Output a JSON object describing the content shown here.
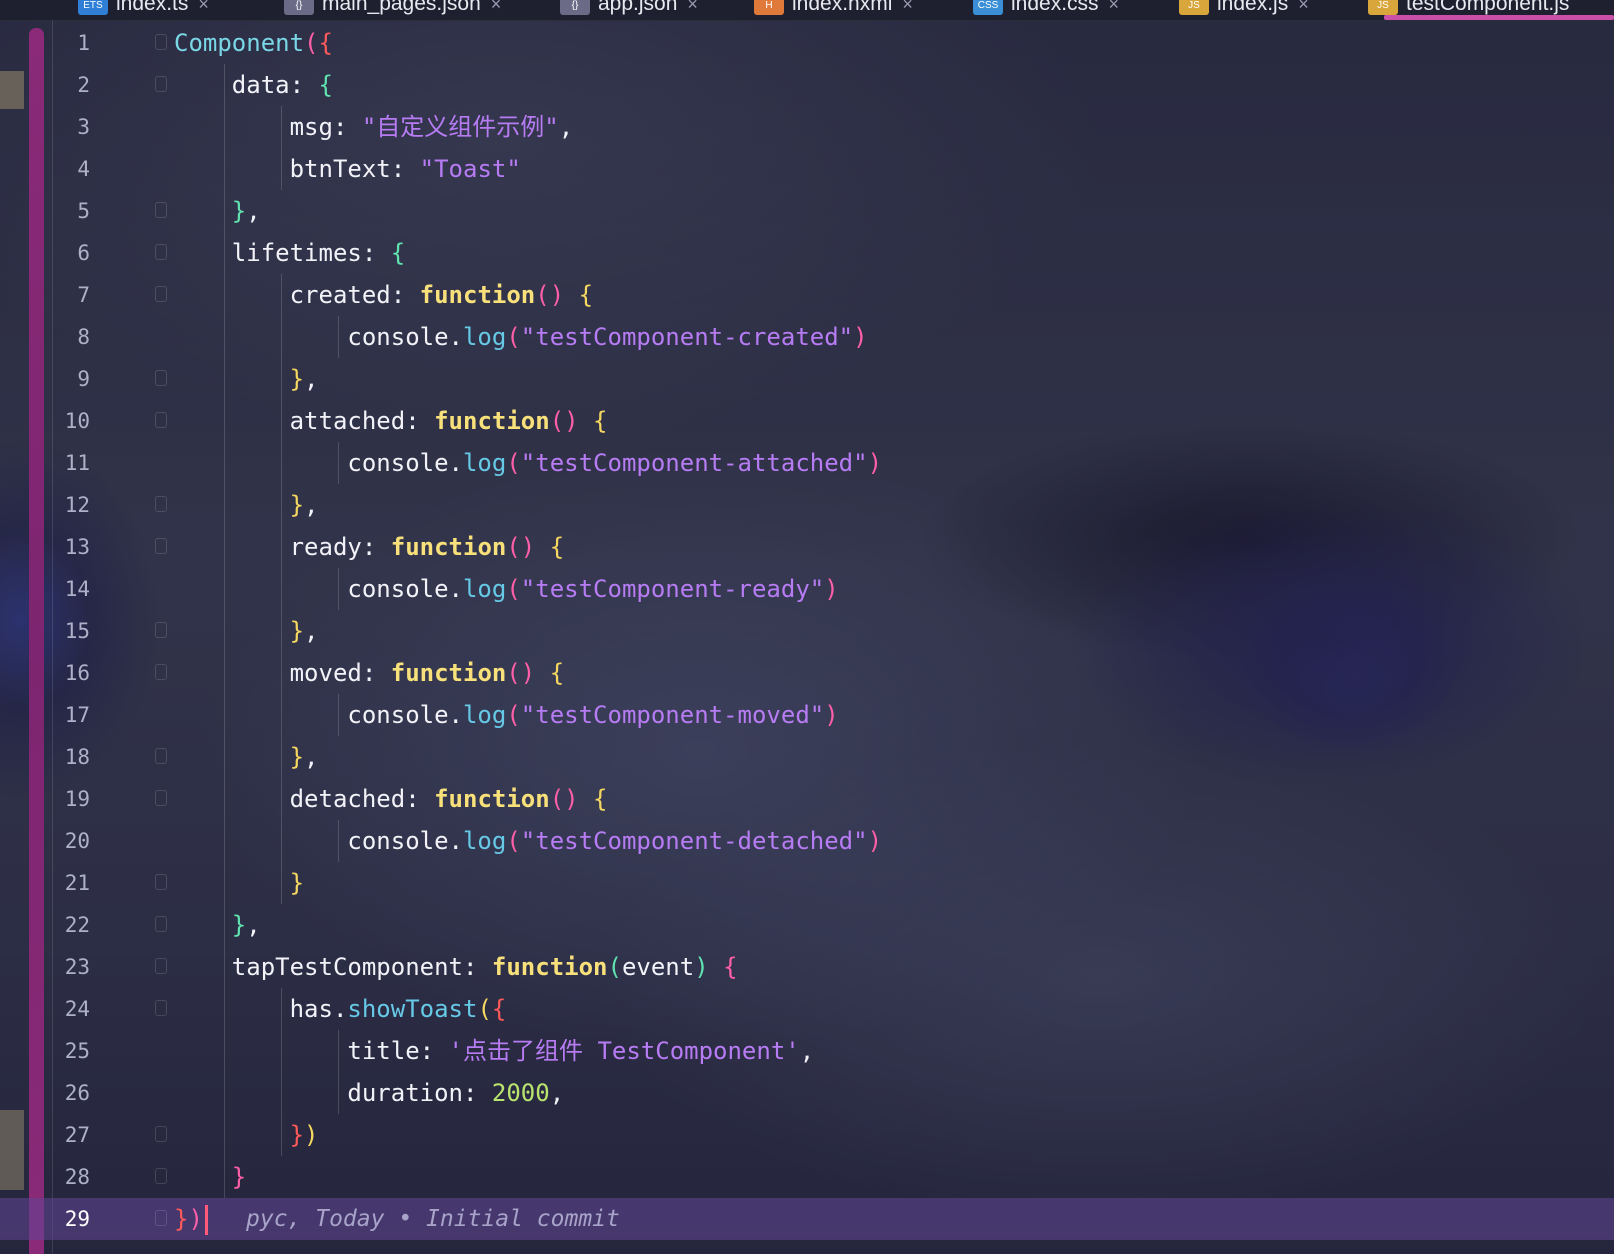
{
  "tabs": [
    {
      "label": "index.ts",
      "icon": "typescript-file-icon",
      "icon_text": "ETS",
      "icon_color": "#2f7fd6"
    },
    {
      "label": "main_pages.json",
      "icon": "json-file-icon",
      "icon_text": "{}",
      "icon_color": "#6b6b88"
    },
    {
      "label": "app.json",
      "icon": "json-file-icon",
      "icon_text": "{}",
      "icon_color": "#6b6b88"
    },
    {
      "label": "index.hxml",
      "icon": "html-file-icon",
      "icon_text": "H",
      "icon_color": "#e07a3a"
    },
    {
      "label": "index.css",
      "icon": "css-file-icon",
      "icon_text": "CSS",
      "icon_color": "#3a8fd6"
    },
    {
      "label": "index.js",
      "icon": "js-file-icon",
      "icon_text": "JS",
      "icon_color": "#d8a63a"
    },
    {
      "label": "testComponent.js",
      "icon": "js-file-icon",
      "icon_text": "JS",
      "icon_color": "#d8a63a",
      "active": true
    }
  ],
  "tab_close_glyph": "×",
  "editor": {
    "current_line": 29,
    "blame": "pyc, Today • Initial commit",
    "colors": {
      "current_line_bg": "#604696",
      "accent_rail": "#8a2a78",
      "active_tab_underline": "#c94fa8"
    },
    "lines": [
      {
        "n": "1",
        "t": [
          [
            "Component",
            "t-cls"
          ],
          [
            "(",
            "br-pink"
          ],
          [
            "{",
            "br-red"
          ]
        ]
      },
      {
        "n": "2",
        "t": [
          [
            "    data",
            "t-key"
          ],
          [
            ": ",
            "t-punc"
          ],
          [
            "{",
            "br-grn"
          ]
        ]
      },
      {
        "n": "3",
        "t": [
          [
            "        msg",
            "t-key"
          ],
          [
            ": ",
            "t-punc"
          ],
          [
            "\"自定义组件示例\"",
            "t-str"
          ],
          [
            ",",
            "t-punc"
          ]
        ]
      },
      {
        "n": "4",
        "t": [
          [
            "        btnText",
            "t-key"
          ],
          [
            ": ",
            "t-punc"
          ],
          [
            "\"Toast\"",
            "t-str"
          ]
        ]
      },
      {
        "n": "5",
        "t": [
          [
            "    ",
            "t-punc"
          ],
          [
            "}",
            "br-grn"
          ],
          [
            ",",
            "t-punc"
          ]
        ]
      },
      {
        "n": "6",
        "t": [
          [
            "    lifetimes",
            "t-key"
          ],
          [
            ": ",
            "t-punc"
          ],
          [
            "{",
            "br-grn"
          ]
        ]
      },
      {
        "n": "7",
        "t": [
          [
            "        created",
            "t-key"
          ],
          [
            ": ",
            "t-punc"
          ],
          [
            "function",
            "t-fn"
          ],
          [
            "()",
            "br-pink"
          ],
          [
            " ",
            "t-punc"
          ],
          [
            "{",
            "br-yel"
          ]
        ]
      },
      {
        "n": "8",
        "t": [
          [
            "            console.",
            "t-key"
          ],
          [
            "log",
            "t-meth"
          ],
          [
            "(",
            "br-pink"
          ],
          [
            "\"testComponent-created\"",
            "t-str"
          ],
          [
            ")",
            "br-pink"
          ]
        ]
      },
      {
        "n": "9",
        "t": [
          [
            "        ",
            "t-punc"
          ],
          [
            "}",
            "br-yel"
          ],
          [
            ",",
            "t-punc"
          ]
        ]
      },
      {
        "n": "10",
        "t": [
          [
            "        attached",
            "t-key"
          ],
          [
            ": ",
            "t-punc"
          ],
          [
            "function",
            "t-fn"
          ],
          [
            "()",
            "br-pink"
          ],
          [
            " ",
            "t-punc"
          ],
          [
            "{",
            "br-yel"
          ]
        ]
      },
      {
        "n": "11",
        "t": [
          [
            "            console.",
            "t-key"
          ],
          [
            "log",
            "t-meth"
          ],
          [
            "(",
            "br-pink"
          ],
          [
            "\"testComponent-attached\"",
            "t-str"
          ],
          [
            ")",
            "br-pink"
          ]
        ]
      },
      {
        "n": "12",
        "t": [
          [
            "        ",
            "t-punc"
          ],
          [
            "}",
            "br-yel"
          ],
          [
            ",",
            "t-punc"
          ]
        ]
      },
      {
        "n": "13",
        "t": [
          [
            "        ready",
            "t-key"
          ],
          [
            ": ",
            "t-punc"
          ],
          [
            "function",
            "t-fn"
          ],
          [
            "()",
            "br-pink"
          ],
          [
            " ",
            "t-punc"
          ],
          [
            "{",
            "br-yel"
          ]
        ]
      },
      {
        "n": "14",
        "t": [
          [
            "            console.",
            "t-key"
          ],
          [
            "log",
            "t-meth"
          ],
          [
            "(",
            "br-pink"
          ],
          [
            "\"testComponent-ready\"",
            "t-str"
          ],
          [
            ")",
            "br-pink"
          ]
        ]
      },
      {
        "n": "15",
        "t": [
          [
            "        ",
            "t-punc"
          ],
          [
            "}",
            "br-yel"
          ],
          [
            ",",
            "t-punc"
          ]
        ]
      },
      {
        "n": "16",
        "t": [
          [
            "        moved",
            "t-key"
          ],
          [
            ": ",
            "t-punc"
          ],
          [
            "function",
            "t-fn"
          ],
          [
            "()",
            "br-pink"
          ],
          [
            " ",
            "t-punc"
          ],
          [
            "{",
            "br-yel"
          ]
        ]
      },
      {
        "n": "17",
        "t": [
          [
            "            console.",
            "t-key"
          ],
          [
            "log",
            "t-meth"
          ],
          [
            "(",
            "br-pink"
          ],
          [
            "\"testComponent-moved\"",
            "t-str"
          ],
          [
            ")",
            "br-pink"
          ]
        ]
      },
      {
        "n": "18",
        "t": [
          [
            "        ",
            "t-punc"
          ],
          [
            "}",
            "br-yel"
          ],
          [
            ",",
            "t-punc"
          ]
        ]
      },
      {
        "n": "19",
        "t": [
          [
            "        detached",
            "t-key"
          ],
          [
            ": ",
            "t-punc"
          ],
          [
            "function",
            "t-fn"
          ],
          [
            "()",
            "br-pink"
          ],
          [
            " ",
            "t-punc"
          ],
          [
            "{",
            "br-yel"
          ]
        ]
      },
      {
        "n": "20",
        "t": [
          [
            "            console.",
            "t-key"
          ],
          [
            "log",
            "t-meth"
          ],
          [
            "(",
            "br-pink"
          ],
          [
            "\"testComponent-detached\"",
            "t-str"
          ],
          [
            ")",
            "br-pink"
          ]
        ]
      },
      {
        "n": "21",
        "t": [
          [
            "        ",
            "t-punc"
          ],
          [
            "}",
            "br-yel"
          ]
        ]
      },
      {
        "n": "22",
        "t": [
          [
            "    ",
            "t-punc"
          ],
          [
            "}",
            "br-grn"
          ],
          [
            ",",
            "t-punc"
          ]
        ]
      },
      {
        "n": "23",
        "t": [
          [
            "    tapTestComponent",
            "t-key"
          ],
          [
            ": ",
            "t-punc"
          ],
          [
            "function",
            "t-fn"
          ],
          [
            "(",
            "br-grn"
          ],
          [
            "event",
            "t-key"
          ],
          [
            ")",
            "br-grn"
          ],
          [
            " ",
            "t-punc"
          ],
          [
            "{",
            "br-pink"
          ]
        ]
      },
      {
        "n": "24",
        "t": [
          [
            "        has.",
            "t-key"
          ],
          [
            "showToast",
            "t-meth"
          ],
          [
            "(",
            "br-yel"
          ],
          [
            "{",
            "br-red"
          ]
        ]
      },
      {
        "n": "25",
        "t": [
          [
            "            title",
            "t-key"
          ],
          [
            ": ",
            "t-punc"
          ],
          [
            "'点击了组件 TestComponent'",
            "t-str"
          ],
          [
            ",",
            "t-punc"
          ]
        ]
      },
      {
        "n": "26",
        "t": [
          [
            "            duration",
            "t-key"
          ],
          [
            ": ",
            "t-punc"
          ],
          [
            "2000",
            "t-num"
          ],
          [
            ",",
            "t-punc"
          ]
        ]
      },
      {
        "n": "27",
        "t": [
          [
            "        ",
            "t-punc"
          ],
          [
            "}",
            "br-red"
          ],
          [
            ")",
            "br-yel"
          ]
        ]
      },
      {
        "n": "28",
        "t": [
          [
            "    ",
            "t-punc"
          ],
          [
            "}",
            "br-pink"
          ]
        ]
      },
      {
        "n": "29",
        "t": [
          [
            "}",
            "br-red"
          ],
          [
            ")",
            "br-pink"
          ]
        ]
      }
    ]
  }
}
